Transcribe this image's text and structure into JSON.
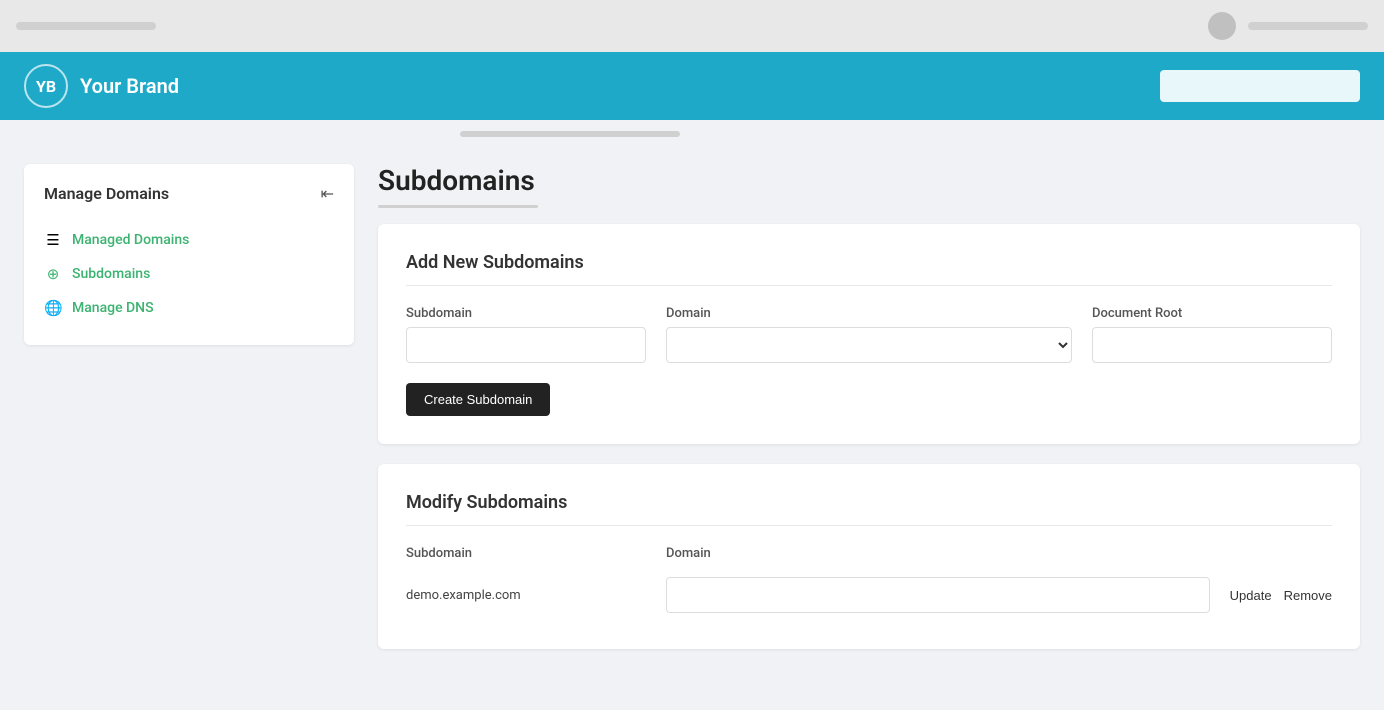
{
  "browser": {
    "scroll_bar_left": "",
    "scroll_bar_right": ""
  },
  "header": {
    "brand_initials": "YB",
    "brand_name": "Your Brand",
    "search_placeholder": ""
  },
  "sidebar": {
    "title": "Manage Domains",
    "collapse_icon": "⇤",
    "items": [
      {
        "id": "managed-domains",
        "label": "Managed Domains",
        "icon": "☰"
      },
      {
        "id": "subdomains",
        "label": "Subdomains",
        "icon": "◎"
      },
      {
        "id": "manage-dns",
        "label": "Manage DNS",
        "icon": "🌐"
      }
    ]
  },
  "main": {
    "page_title": "Subdomains",
    "add_section": {
      "title": "Add New Subdomains",
      "subdomain_label": "Subdomain",
      "domain_label": "Domain",
      "document_root_label": "Document Root",
      "create_button_label": "Create Subdomain"
    },
    "modify_section": {
      "title": "Modify Subdomains",
      "subdomain_col_label": "Subdomain",
      "domain_col_label": "Domain",
      "rows": [
        {
          "subdomain": "demo.example.com",
          "domain": "",
          "update_label": "Update",
          "remove_label": "Remove"
        }
      ]
    }
  }
}
